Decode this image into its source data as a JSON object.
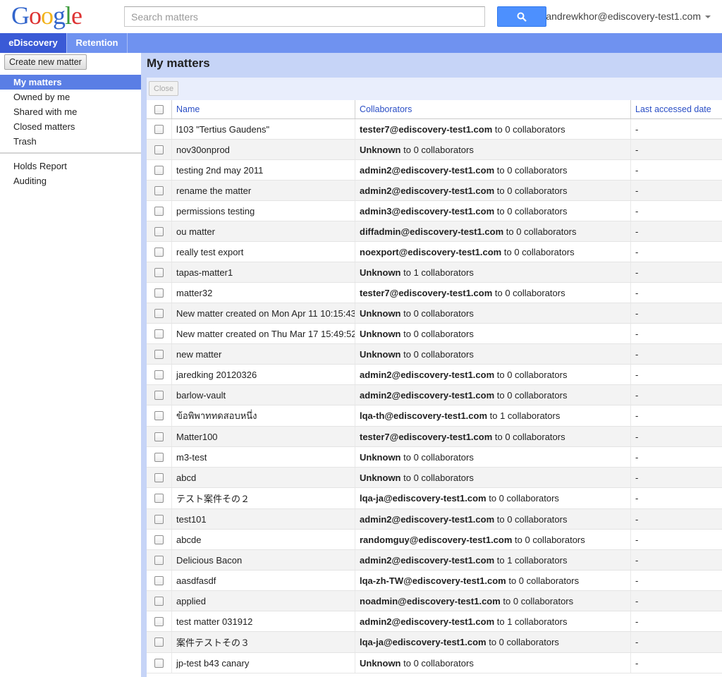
{
  "logo": {
    "letters": [
      "G",
      "o",
      "o",
      "g",
      "l",
      "e"
    ]
  },
  "search": {
    "placeholder": "Search matters",
    "value": ""
  },
  "account": {
    "email": "andrewkhor@ediscovery-test1.com"
  },
  "tabs": [
    {
      "label": "eDiscovery",
      "active": true
    },
    {
      "label": "Retention",
      "active": false
    }
  ],
  "sidebar": {
    "create_label": "Create new matter",
    "items": [
      {
        "label": "My matters",
        "active": true
      },
      {
        "label": "Owned by me"
      },
      {
        "label": "Shared with me"
      },
      {
        "label": "Closed matters"
      },
      {
        "label": "Trash"
      },
      {
        "label": "Holds Report"
      },
      {
        "label": "Auditing"
      }
    ]
  },
  "main": {
    "title": "My matters",
    "close_label": "Close",
    "columns": {
      "name": "Name",
      "collaborators": "Collaborators",
      "last_accessed": "Last accessed date"
    },
    "rows": [
      {
        "name": "l103 \"Tertius Gaudens\"",
        "collab_user": "tester7@ediscovery-test1.com",
        "collab_rest": " to 0 collaborators",
        "date": "-"
      },
      {
        "name": "nov30onprod",
        "collab_user": "Unknown",
        "collab_rest": " to 0 collaborators",
        "date": "-"
      },
      {
        "name": "testing 2nd may 2011",
        "collab_user": "admin2@ediscovery-test1.com",
        "collab_rest": " to 0 collaborators",
        "date": "-"
      },
      {
        "name": "rename the matter",
        "collab_user": "admin2@ediscovery-test1.com",
        "collab_rest": " to 0 collaborators",
        "date": "-"
      },
      {
        "name": "permissions testing",
        "collab_user": "admin3@ediscovery-test1.com",
        "collab_rest": " to 0 collaborators",
        "date": "-"
      },
      {
        "name": "ou matter",
        "collab_user": "diffadmin@ediscovery-test1.com",
        "collab_rest": " to 0 collaborators",
        "date": "-"
      },
      {
        "name": "really test export",
        "collab_user": "noexport@ediscovery-test1.com",
        "collab_rest": " to 0 collaborators",
        "date": "-"
      },
      {
        "name": "tapas-matter1",
        "collab_user": "Unknown",
        "collab_rest": " to 1 collaborators",
        "date": "-"
      },
      {
        "name": "matter32",
        "collab_user": "tester7@ediscovery-test1.com",
        "collab_rest": " to 0 collaborators",
        "date": "-"
      },
      {
        "name": "New matter created on Mon Apr 11 10:15:43",
        "collab_user": "Unknown",
        "collab_rest": " to 0 collaborators",
        "date": "-"
      },
      {
        "name": "New matter created on Thu Mar 17 15:49:52",
        "collab_user": "Unknown",
        "collab_rest": " to 0 collaborators",
        "date": "-"
      },
      {
        "name": "new matter",
        "collab_user": "Unknown",
        "collab_rest": " to 0 collaborators",
        "date": "-"
      },
      {
        "name": "jaredking 20120326",
        "collab_user": "admin2@ediscovery-test1.com",
        "collab_rest": " to 0 collaborators",
        "date": "-"
      },
      {
        "name": "barlow-vault",
        "collab_user": "admin2@ediscovery-test1.com",
        "collab_rest": " to 0 collaborators",
        "date": "-"
      },
      {
        "name": "ข้อพิพาททดสอบหนึ่ง",
        "collab_user": "lqa-th@ediscovery-test1.com",
        "collab_rest": " to 1 collaborators",
        "date": "-"
      },
      {
        "name": "Matter100",
        "collab_user": "tester7@ediscovery-test1.com",
        "collab_rest": " to 0 collaborators",
        "date": "-"
      },
      {
        "name": "m3-test",
        "collab_user": "Unknown",
        "collab_rest": " to 0 collaborators",
        "date": "-"
      },
      {
        "name": "abcd",
        "collab_user": "Unknown",
        "collab_rest": " to 0 collaborators",
        "date": "-"
      },
      {
        "name": "テスト案件その２",
        "collab_user": "lqa-ja@ediscovery-test1.com",
        "collab_rest": " to 0 collaborators",
        "date": "-"
      },
      {
        "name": "test101",
        "collab_user": "admin2@ediscovery-test1.com",
        "collab_rest": " to 0 collaborators",
        "date": "-"
      },
      {
        "name": "abcde",
        "collab_user": "randomguy@ediscovery-test1.com",
        "collab_rest": " to 0 collaborators",
        "date": "-"
      },
      {
        "name": "Delicious Bacon",
        "collab_user": "admin2@ediscovery-test1.com",
        "collab_rest": " to 1 collaborators",
        "date": "-"
      },
      {
        "name": "aasdfasdf",
        "collab_user": "lqa-zh-TW@ediscovery-test1.com",
        "collab_rest": " to 0 collaborators",
        "date": "-"
      },
      {
        "name": "applied",
        "collab_user": "noadmin@ediscovery-test1.com",
        "collab_rest": " to 0 collaborators",
        "date": "-"
      },
      {
        "name": "test matter 031912",
        "collab_user": "admin2@ediscovery-test1.com",
        "collab_rest": " to 1 collaborators",
        "date": "-"
      },
      {
        "name": "案件テストその３",
        "collab_user": "lqa-ja@ediscovery-test1.com",
        "collab_rest": " to 0 collaborators",
        "date": "-"
      },
      {
        "name": "jp-test b43 canary",
        "collab_user": "Unknown",
        "collab_rest": " to 0 collaborators",
        "date": "-"
      }
    ]
  },
  "icons": {
    "search": "search-icon",
    "account_menu": "chevron-down-icon"
  },
  "colors": {
    "accent": "#4d90fe",
    "tab_active": "#3a5ad6",
    "tabbar": "#6f92f0",
    "sidebar_active": "#5a7ee5",
    "header_link": "#2a4ec5"
  }
}
